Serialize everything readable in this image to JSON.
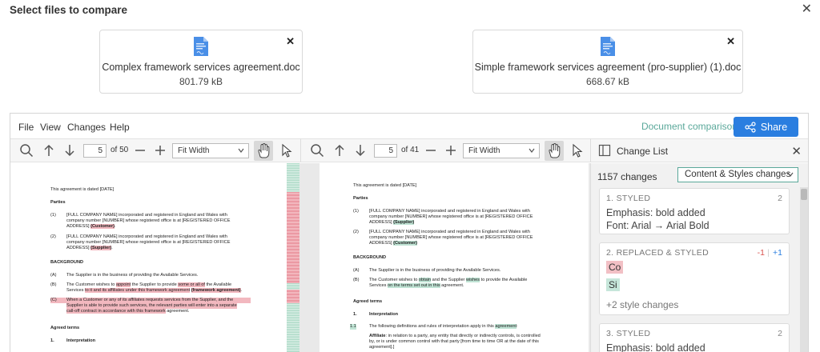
{
  "dialog": {
    "title": "Select files to compare",
    "close": "✕"
  },
  "files": [
    {
      "name": "Complex framework services agreement.doc",
      "size": "801.79 kB",
      "remove": "✕"
    },
    {
      "name": "Simple framework services agreement (pro-supplier) (1).doc",
      "size": "668.67 kB",
      "remove": "✕"
    }
  ],
  "menu": {
    "file": "File",
    "view": "View",
    "changes": "Changes",
    "help": "Help"
  },
  "header": {
    "doc_comparison": "Document comparison",
    "share": "Share"
  },
  "left_toolbar": {
    "page": "5",
    "of": "of 50",
    "zoom": "Fit Width"
  },
  "mid_toolbar": {
    "page": "5",
    "of": "of 41",
    "zoom": "Fit Width"
  },
  "change_list": {
    "title": "Change List",
    "close": "✕",
    "count": "1157 changes",
    "filter": "Content & Styles changes",
    "cards": [
      {
        "type": "1. STYLED",
        "num": "2",
        "line1": "Emphasis: bold added",
        "line2_a": "Font: Arial",
        "arrow": "→",
        "line2_b": "Arial Bold"
      },
      {
        "type": "2. REPLACED & STYLED",
        "minus": "-1",
        "sep": "|",
        "plus": "+1",
        "del": "Co",
        "ins": "Si",
        "more": "+2 style changes"
      },
      {
        "type": "3. STYLED",
        "num": "2",
        "line1": "Emphasis: bold added"
      }
    ]
  },
  "left_doc": {
    "dated": "This agreement is dated [DATE]",
    "parties": "Parties",
    "p1_num": "(1)",
    "p1_l1": "[FULL COMPANY NAME] incorporated and registered in England and Wales with",
    "p1_l2": "company number [NUMBER] whose registered office is at [REGISTERED OFFICE",
    "p1_l3a": "ADDRESS] ",
    "p1_l3b": "(Customer)",
    "p1_l3c": ".",
    "p2_num": "(2)",
    "p2_l1": "[FULL COMPANY NAME] incorporated and registered in England and Wales with",
    "p2_l2": "company number [NUMBER] whose registered office is at [REGISTERED OFFICE",
    "p2_l3a": "ADDRESS] ",
    "p2_l3b": "(Supplier)",
    "p2_l3c": ".",
    "background": "BACKGROUND",
    "a_num": "(A)",
    "a_text": "The Supplier is in the business of providing the Available Services.",
    "b_num": "(B)",
    "b_l1a": "The Customer wishes to ",
    "b_l1b": "appoint",
    "b_l1c": " the Supplier to provide ",
    "b_l1d": "some or all of",
    "b_l1e": " the Available",
    "b_l2a": "Services ",
    "b_l2b": "to it and its affiliates under this framework agreement",
    "b_l2c": " ",
    "b_l2d": "(framework agreement)",
    "b_l2e": ".",
    "c_num": "(C)",
    "c_l1": "When a Customer or any of its affiliates requests services from the Supplier, and the",
    "c_l2": "Supplier is able to provide such services, the relevant parties will enter into a separate",
    "c_l3a": "call-off contract in accordance with this ",
    "c_l3b": "framework",
    "c_l3c": " agreement.",
    "agreed": "Agreed terms",
    "i_num": "1.",
    "interp": "Interpretation"
  },
  "mid_doc": {
    "dated": "This agreement is dated [DATE]",
    "parties": "Parties",
    "p1_num": "(1)",
    "p1_l1": "[FULL COMPANY NAME] incorporated and registered in England and Wales with",
    "p1_l2": "company number [NUMBER] whose registered office is at [REGISTERED OFFICE",
    "p1_l3a": "ADDRESS] ",
    "p1_l3b": "(Supplier)",
    "p2_num": "(2)",
    "p2_l1": "[FULL COMPANY NAME] incorporated and registered in England and Wales with",
    "p2_l2": "company number [NUMBER] whose registered office is at [REGISTERED OFFICE",
    "p2_l3a": "ADDRESS] ",
    "p2_l3b": "(Customer)",
    "background": "BACKGROUND",
    "a_num": "(A)",
    "a_text": "The Supplier is in the business of providing the Available Services.",
    "b_num": "(B)",
    "b_l1a": "The Customer wishes to ",
    "b_l1b": "obtain",
    "b_l1c": " and the Supplier ",
    "b_l1d": "wishes",
    "b_l1e": " to provide the Available",
    "b_l2a": "Services ",
    "b_l2b": "on the terms set out in this",
    "b_l2c": " agreement.",
    "agreed": "Agreed terms",
    "i_num": "1.",
    "interp": "Interpretation",
    "d_num": "1.1",
    "d_l1a": "The following definitions and rules of interpretation apply in this ",
    "d_l1b": "agreement",
    "d_l1c": ":",
    "d_l2a": "Affiliate",
    "d_l2b": ": in relation to a party, any entity that directly or indirectly controls, is controlled",
    "d_l3": "by, or is under common control with that party [from time to time OR at the date of this",
    "d_l4": "agreement].]"
  }
}
